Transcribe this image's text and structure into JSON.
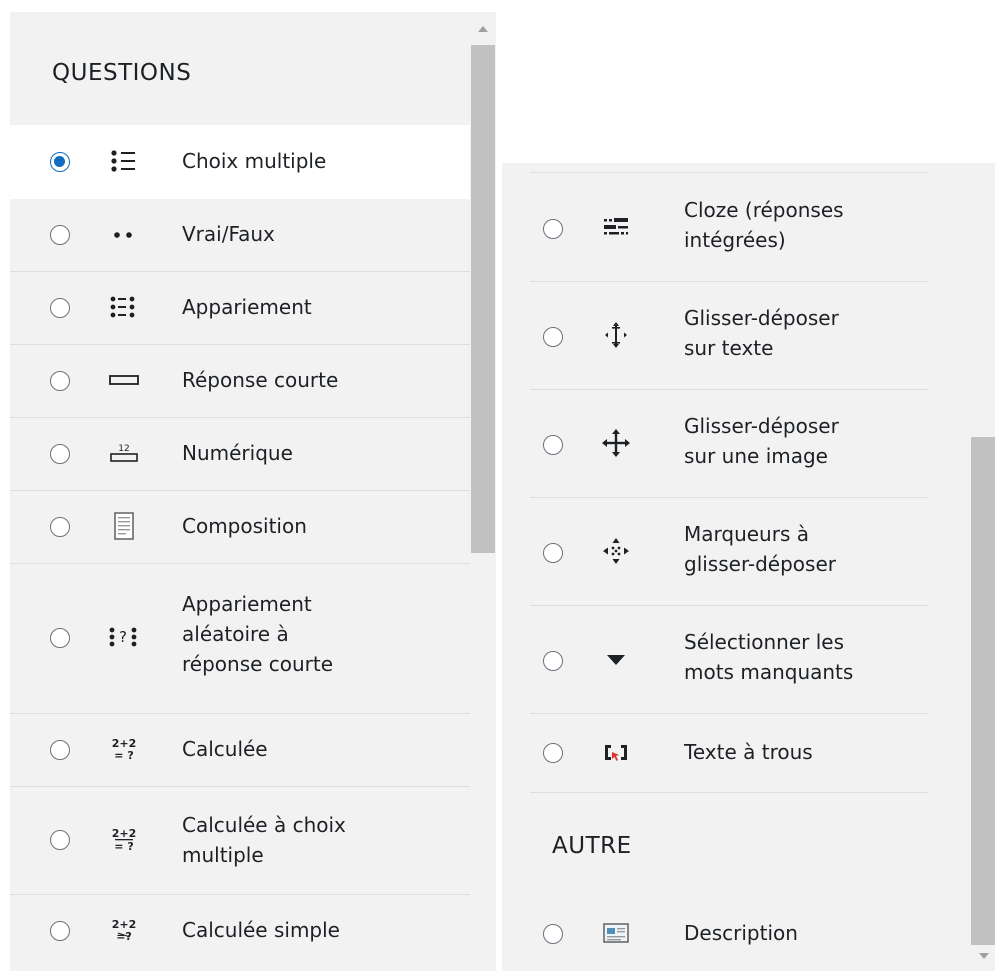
{
  "left": {
    "section_title": "QUESTIONS",
    "items": [
      {
        "label": "Choix multiple",
        "icon": "multichoice-icon",
        "selected": true
      },
      {
        "label": "Vrai/Faux",
        "icon": "truefalse-icon"
      },
      {
        "label": "Appariement",
        "icon": "match-icon"
      },
      {
        "label": "Réponse courte",
        "icon": "shortanswer-icon"
      },
      {
        "label": "Numérique",
        "icon": "numerical-icon"
      },
      {
        "label": "Composition",
        "icon": "essay-icon"
      },
      {
        "label": "Appariement aléatoire à réponse courte",
        "line1": "Appariement",
        "line2": "aléatoire à",
        "line3": "réponse courte",
        "icon": "randomsamatch-icon"
      },
      {
        "label": "Calculée",
        "icon": "calculated-icon"
      },
      {
        "label": "Calculée à choix multiple",
        "line1": "Calculée à choix",
        "line2": "multiple",
        "icon": "calculatedmulti-icon"
      },
      {
        "label": "Calculée simple",
        "icon": "calculatedsimple-icon"
      }
    ]
  },
  "right": {
    "items": [
      {
        "line1": "Cloze (réponses",
        "line2": "intégrées)",
        "icon": "cloze-icon"
      },
      {
        "line1": "Glisser-déposer",
        "line2": "sur texte",
        "icon": "ddwtos-icon"
      },
      {
        "line1": "Glisser-déposer",
        "line2": "sur une image",
        "icon": "ddimageortext-icon"
      },
      {
        "line1": "Marqueurs à",
        "line2": "glisser-déposer",
        "icon": "ddmarker-icon"
      },
      {
        "line1": "Sélectionner les",
        "line2": "mots manquants",
        "icon": "gapselect-icon"
      },
      {
        "label": "Texte à trous",
        "icon": "gapfill-icon"
      }
    ],
    "section_title": "AUTRE",
    "other": [
      {
        "label": "Description",
        "icon": "description-icon"
      }
    ]
  },
  "colors": {
    "accent": "#0f6cbf",
    "panel": "#f2f2f2",
    "divider": "#dedede"
  }
}
